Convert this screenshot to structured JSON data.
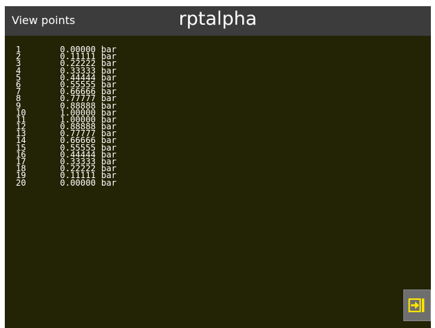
{
  "header": {
    "left_title": "View points",
    "center_title": "rptalpha"
  },
  "points": [
    {
      "index": "1",
      "value": "0.00000",
      "unit": "bar"
    },
    {
      "index": "2",
      "value": "0.11111",
      "unit": "bar"
    },
    {
      "index": "3",
      "value": "0.22222",
      "unit": "bar"
    },
    {
      "index": "4",
      "value": "0.33333",
      "unit": "bar"
    },
    {
      "index": "5",
      "value": "0.44444",
      "unit": "bar"
    },
    {
      "index": "6",
      "value": "0.55555",
      "unit": "bar"
    },
    {
      "index": "7",
      "value": "0.66666",
      "unit": "bar"
    },
    {
      "index": "8",
      "value": "0.77777",
      "unit": "bar"
    },
    {
      "index": "9",
      "value": "0.88888",
      "unit": "bar"
    },
    {
      "index": "10",
      "value": "1.00000",
      "unit": "bar"
    },
    {
      "index": "11",
      "value": "1.00000",
      "unit": "bar"
    },
    {
      "index": "12",
      "value": "0.88888",
      "unit": "bar"
    },
    {
      "index": "13",
      "value": "0.77777",
      "unit": "bar"
    },
    {
      "index": "14",
      "value": "0.66666",
      "unit": "bar"
    },
    {
      "index": "15",
      "value": "0.55555",
      "unit": "bar"
    },
    {
      "index": "16",
      "value": "0.44444",
      "unit": "bar"
    },
    {
      "index": "17",
      "value": "0.33333",
      "unit": "bar"
    },
    {
      "index": "18",
      "value": "0.22222",
      "unit": "bar"
    },
    {
      "index": "19",
      "value": "0.11111",
      "unit": "bar"
    },
    {
      "index": "20",
      "value": "0.00000",
      "unit": "bar"
    }
  ],
  "exit_button": {
    "icon": "exit-arrow-icon",
    "icon_color": "#ffe600"
  },
  "colors": {
    "screen_background": "#232306",
    "header_background": "#3c3c3c",
    "text": "#ffffff",
    "button_background": "#6e6e6e"
  }
}
